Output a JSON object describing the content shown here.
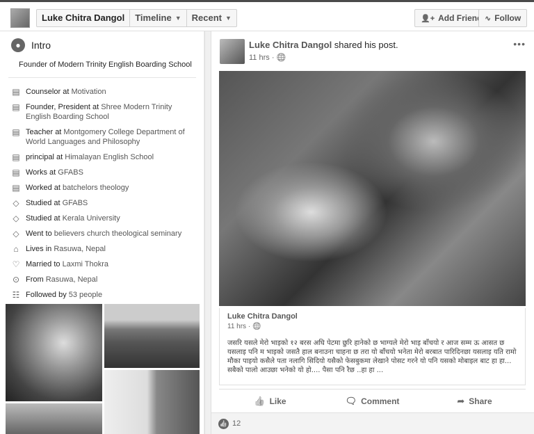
{
  "topbar": {
    "profile_name": "Luke Chitra Dangol",
    "timeline_label": "Timeline",
    "recent_label": "Recent",
    "add_friend_label": "Add Friend",
    "follow_label": "Follow"
  },
  "intro": {
    "title": "Intro",
    "bio": "Founder of Modern Trinity English Boarding School",
    "items": [
      {
        "icon": "briefcase-icon",
        "pre": "Counselor at ",
        "link": "Motivation"
      },
      {
        "icon": "briefcase-icon",
        "pre": "Founder, President at ",
        "link": "Shree Modern Trinity English Boarding School"
      },
      {
        "icon": "briefcase-icon",
        "pre": "Teacher at ",
        "link": "Montgomery College Department of World Languages and Philosophy"
      },
      {
        "icon": "briefcase-icon",
        "pre": "principal at ",
        "link": "Himalayan English School"
      },
      {
        "icon": "briefcase-icon",
        "pre": "Works at ",
        "link": "GFABS"
      },
      {
        "icon": "briefcase-icon",
        "pre": "Worked at ",
        "link": "batchelors theology"
      },
      {
        "icon": "graduation-cap-icon",
        "pre": "Studied at ",
        "link": "GFABS"
      },
      {
        "icon": "graduation-cap-icon",
        "pre": "Studied at ",
        "link": "Kerala University"
      },
      {
        "icon": "graduation-cap-icon",
        "pre": "Went to ",
        "link": "believers church theological seminary"
      },
      {
        "icon": "home-icon",
        "pre": "Lives in ",
        "link": "Rasuwa, Nepal"
      },
      {
        "icon": "heart-icon",
        "pre": "Married to ",
        "link": "Laxmi Thokra"
      },
      {
        "icon": "location-pin-icon",
        "pre": "From ",
        "link": "Rasuwa, Nepal"
      },
      {
        "icon": "followers-icon",
        "pre": "Followed by ",
        "link": "53 people"
      }
    ]
  },
  "post": {
    "author": "Luke Chitra Dangol",
    "action": " shared his post.",
    "time": "11 hrs",
    "shared_author": "Luke Chitra Dangol",
    "shared_time": "11 hrs",
    "shared_text": "जसरि यसले मेरो भाइको १२ बरस अघि पेटमा छुरि हानेको छ भाग्यले मेरो भाइ बाँचयो र आज सम्म ऊ आसत छ यसलाइ पनि म भाइको जसतै हाल बनाउना चाहना छ तरा यो बाँचयो भनेता मेरो बरबात पारिदिनछा यसलाइ यति रामो मौका पाइयो कसैले पता नलागि सिदियो यसैको फेसबुकमा लेखाने पोसट गरने यो पनि यसको मोबाइल बाट हा हा... सबैको पालो आउछा भनेको यो हो.... पैसा पनि रैछ ..हा हा ...",
    "like_label": "Like",
    "comment_label": "Comment",
    "share_label": "Share",
    "reaction_count": "12"
  }
}
